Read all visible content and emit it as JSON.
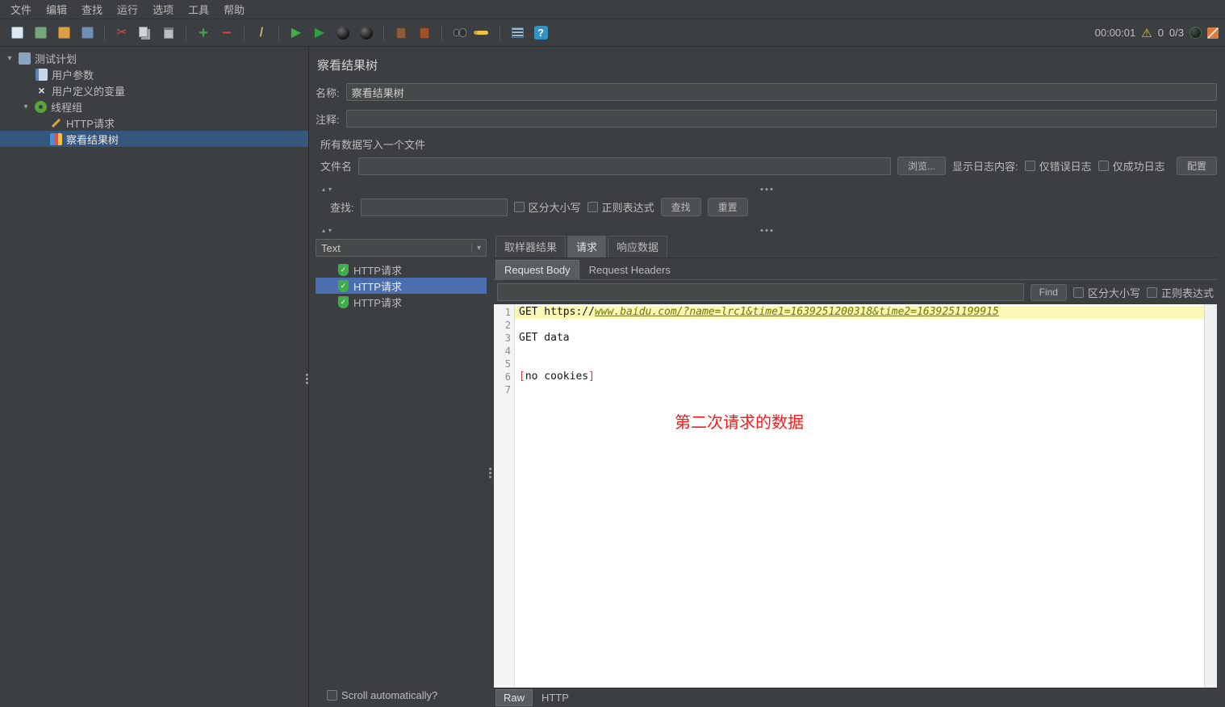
{
  "colors": {
    "tree_selection": "#35567d",
    "list_selection": "#4b6eaf",
    "editor_highlight": "#fbf7b5",
    "link_olive": "#6e7b00",
    "annotation_red": "#ff1a1a",
    "shield_green": "#3fae49",
    "warning_yellow": "#e6c229",
    "panel_bg": "#3c3f41",
    "editor_bg": "#ffffff"
  },
  "icons": {
    "chevron_down": "▾",
    "arrow_up_small": "▴",
    "arrow_down_small": "▾",
    "plus": "+",
    "minus": "−",
    "play": "▶",
    "scissors": "✂",
    "cross": "×",
    "check": "✓",
    "question": "?",
    "warning": "⚠",
    "slash": "/"
  },
  "menubar": {
    "items": [
      "文件",
      "编辑",
      "查找",
      "运行",
      "选项",
      "工具",
      "帮助"
    ]
  },
  "toolbar": {
    "timer": "00:00:01",
    "warning_count": "0",
    "thread_count": "0/3"
  },
  "tree": {
    "items": [
      "测试计划",
      "用户参数",
      "用户定义的变量",
      "线程组",
      "HTTP请求",
      "察看结果树"
    ],
    "selected": "察看结果树"
  },
  "main": {
    "title": "察看结果树",
    "name_label": "名称:",
    "name_value": "察看结果树",
    "comment_label": "注释:",
    "comment_value": "",
    "file_section": {
      "title": "所有数据写入一个文件",
      "filename_label": "文件名",
      "filename_value": "",
      "browse_button": "浏览...",
      "log_display_label": "显示日志内容:",
      "errors_only": "仅错误日志",
      "success_only": "仅成功日志",
      "config_button": "配置"
    },
    "search_bar": {
      "label": "查找:",
      "query_value": "",
      "case_sensitive": "区分大小写",
      "regex": "正则表达式",
      "find_button": "查找",
      "reset_button": "重置"
    },
    "results": {
      "view_mode": "Text",
      "items": [
        "HTTP请求",
        "HTTP请求",
        "HTTP请求"
      ],
      "selected_index": 1,
      "scroll_auto_label": "Scroll automatically?"
    },
    "detail": {
      "tabs": [
        "取样器结果",
        "请求",
        "响应数据"
      ],
      "active_tab": "请求",
      "sub_tabs": [
        "Request Body",
        "Request Headers"
      ],
      "active_sub_tab": "Request Body",
      "search_value": "",
      "find_button": "Find",
      "case_sensitive": "区分大小写",
      "regex": "正则表达式",
      "editor": {
        "line_numbers": [
          "1",
          "2",
          "3",
          "4",
          "5",
          "6",
          "7"
        ],
        "line1_prefix": "GET https://",
        "line1_url": "www.baidu.com/?name=lrc1&time1=1639251200318&time2=1639251199915",
        "line3_text": "GET data",
        "line6_open": "[",
        "line6_text": "no cookies",
        "line6_close": "]",
        "annotation": "第二次请求的数据"
      },
      "bottom_tabs": [
        "Raw",
        "HTTP"
      ],
      "active_bottom_tab": "Raw"
    }
  }
}
